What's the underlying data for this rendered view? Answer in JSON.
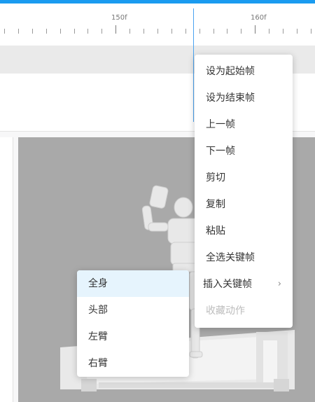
{
  "timeline": {
    "labels": [
      "150f",
      "160f"
    ]
  },
  "context_menu": {
    "items": [
      {
        "label": "设为起始帧",
        "enabled": true
      },
      {
        "label": "设为结束帧",
        "enabled": true
      },
      {
        "label": "上一帧",
        "enabled": true
      },
      {
        "label": "下一帧",
        "enabled": true
      },
      {
        "label": "剪切",
        "enabled": true
      },
      {
        "label": "复制",
        "enabled": true
      },
      {
        "label": "粘贴",
        "enabled": true
      },
      {
        "label": "全选关键帧",
        "enabled": true
      },
      {
        "label": "插入关键帧",
        "enabled": true,
        "has_submenu": true
      },
      {
        "label": "收藏动作",
        "enabled": false
      }
    ],
    "submenu_chevron": "›"
  },
  "submenu": {
    "items": [
      {
        "label": "全身",
        "highlighted": true
      },
      {
        "label": "头部"
      },
      {
        "label": "左臂"
      },
      {
        "label": "右臂"
      }
    ]
  },
  "colors": {
    "accent": "#1a9bf0",
    "viewport_bg": "#a9a9a9",
    "hover_bg": "#e6f4fd"
  }
}
